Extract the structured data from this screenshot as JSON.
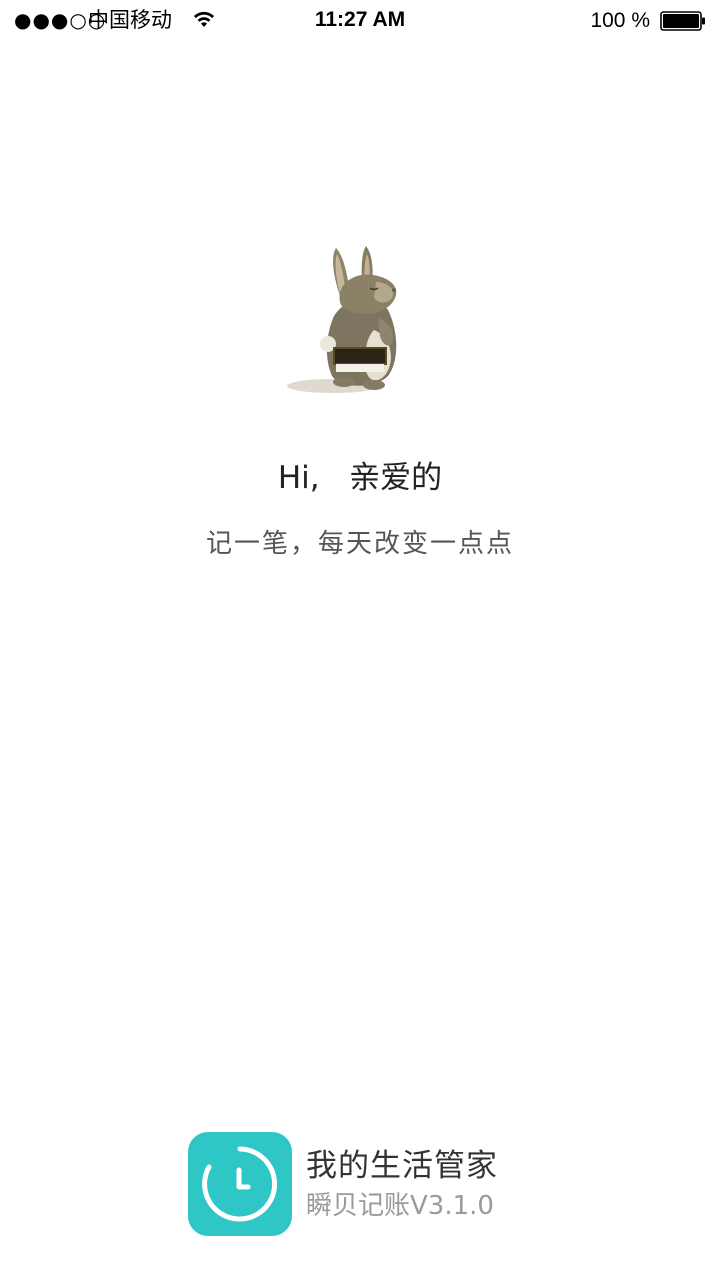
{
  "status_bar": {
    "signal": "●●●○○",
    "carrier": "中国移动",
    "time": "11:27 AM",
    "battery_percent": "100 %",
    "battery_level": 1.0,
    "icons": [
      "wifi-icon",
      "battery-icon"
    ]
  },
  "splash": {
    "illustration": "rabbit-illustration",
    "greeting": "Hi,   亲爱的",
    "subtitle": "记一笔，每天改变一点点"
  },
  "footer": {
    "app_icon": "clock-icon",
    "app_name": "我的生活管家",
    "app_version": "瞬贝记账V3.1.0"
  },
  "colors": {
    "accent": "#2fc6c6",
    "background": "#ffffff"
  }
}
